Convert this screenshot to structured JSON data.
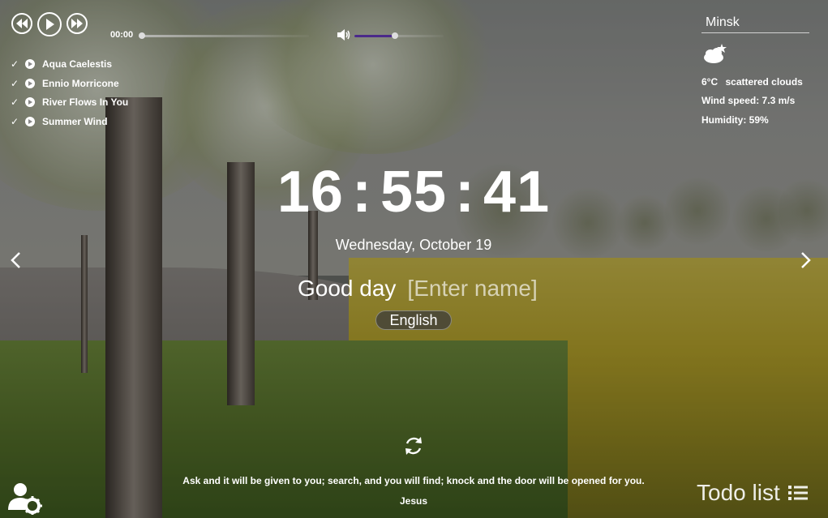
{
  "player": {
    "current_time": "00:00",
    "progress": 0,
    "volume": 0.55,
    "playlist": [
      {
        "title": "Aqua Caelestis"
      },
      {
        "title": "Ennio Morricone"
      },
      {
        "title": "River Flows In You"
      },
      {
        "title": "Summer Wind"
      }
    ]
  },
  "weather": {
    "city": "Minsk",
    "temperature": "6°C",
    "description": "scattered clouds",
    "wind": "Wind speed: 7.3 m/s",
    "humidity": "Humidity: 59%"
  },
  "clock": {
    "hours": "16",
    "minutes": "55",
    "seconds": "41"
  },
  "date": "Wednesday, October 19",
  "greeting": {
    "text": "Good day",
    "name_placeholder": "[Enter name]"
  },
  "language": "English",
  "quote": {
    "text": "Ask and it will be given to you; search, and you will find; knock and the door will be opened for you.",
    "author": "Jesus"
  },
  "todo": {
    "label": "Todo list"
  },
  "colors": {
    "volume_fill": "#4b2a8a",
    "track": "#c9c9c9"
  }
}
